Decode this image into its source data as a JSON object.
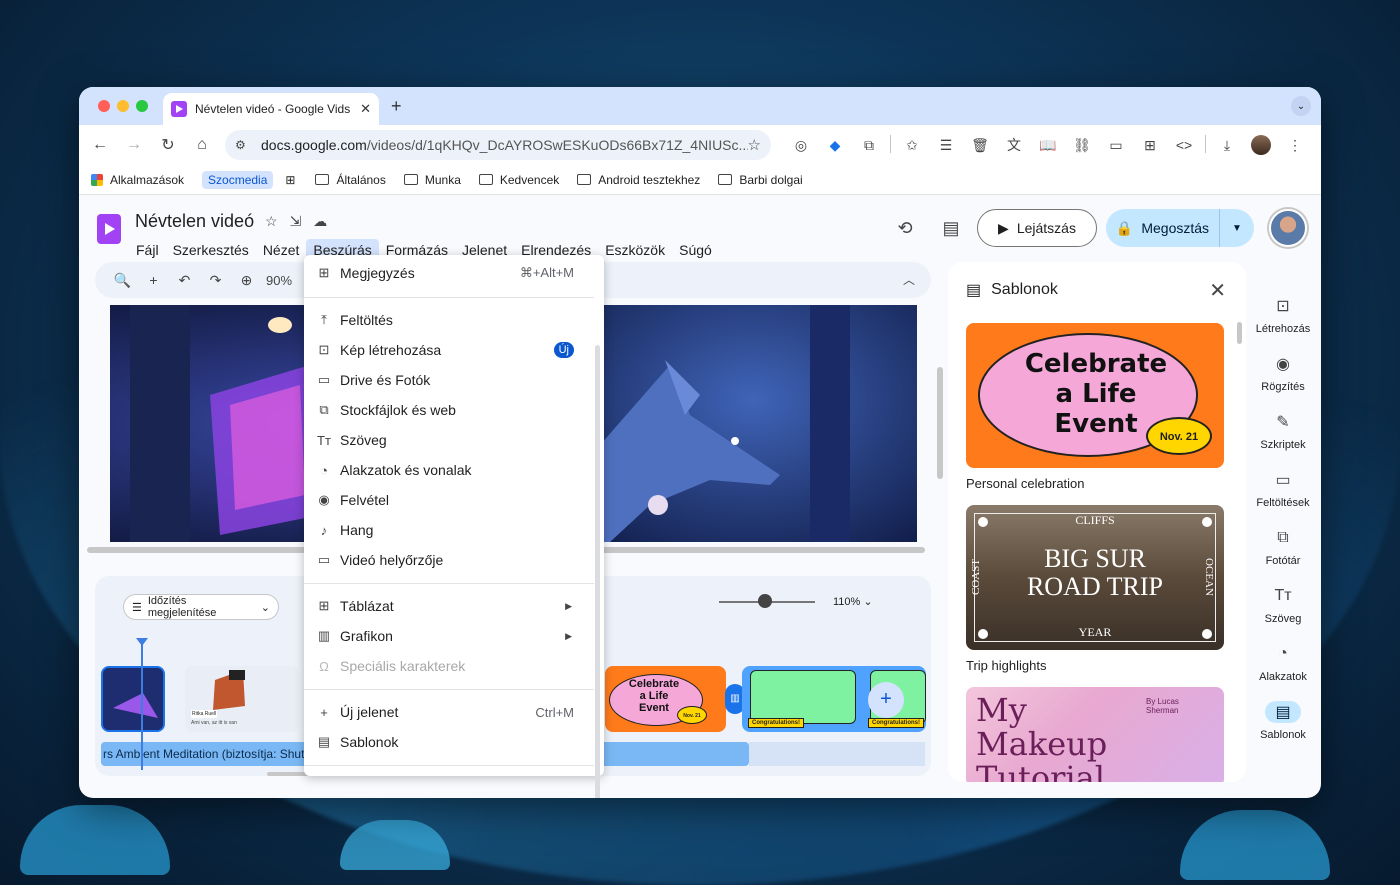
{
  "browser": {
    "tab_title": "Névtelen videó - Google Vids",
    "url_host": "docs.google.com",
    "url_path": "/videos/d/1qKHQv_DcAYROSwESKuODs66Bx71Z_4NIUSc...",
    "bookmarks": [
      "Alkalmazások",
      "Szocmedia",
      "Általános",
      "Munka",
      "Kedvencek",
      "Android tesztekhez",
      "Barbi dolgai"
    ]
  },
  "app": {
    "doc_title": "Névtelen videó",
    "menus": [
      "Fájl",
      "Szerkesztés",
      "Nézet",
      "Beszúrás",
      "Formázás",
      "Jelenet",
      "Elrendezés",
      "Eszközök",
      "Súgó"
    ],
    "play_label": "Lejátszás",
    "share_label": "Megosztás"
  },
  "editor": {
    "zoom": "90%",
    "timing_label": "Időzítés megjelenítése",
    "timeline_zoom": "110%",
    "audio_label": "rs Ambient Meditation (biztosítja: Shutte",
    "slider_level": 0.48
  },
  "insert_menu": {
    "items": [
      {
        "label": "Megjegyzés",
        "shortcut": "⌘+Alt+M",
        "icon": "comment-add-icon"
      },
      {
        "label": "Feltöltés",
        "icon": "upload-icon"
      },
      {
        "label": "Kép létrehozása",
        "badge": "Új",
        "icon": "image-create-icon"
      },
      {
        "label": "Drive és Fotók",
        "icon": "folder-icon"
      },
      {
        "label": "Stockfájlok és web",
        "icon": "stock-image-icon"
      },
      {
        "label": "Szöveg",
        "icon": "text-icon"
      },
      {
        "label": "Alakzatok és vonalak",
        "icon": "shapes-icon"
      },
      {
        "label": "Felvétel",
        "icon": "record-icon"
      },
      {
        "label": "Hang",
        "icon": "mic-icon"
      },
      {
        "label": "Videó helyőrzője",
        "icon": "video-placeholder-icon"
      },
      {
        "label": "Táblázat",
        "icon": "table-icon"
      },
      {
        "label": "Grafikon",
        "icon": "chart-icon"
      },
      {
        "label": "Speciális karakterek",
        "icon": "omega-icon"
      },
      {
        "label": "Új jelenet",
        "shortcut": "Ctrl+M",
        "icon": "plus-icon"
      },
      {
        "label": "Sablonok",
        "icon": "template-icon"
      }
    ]
  },
  "templates_panel": {
    "title": "Sablonok",
    "templates": [
      {
        "label": "Personal celebration",
        "line1": "Celebrate",
        "line2": "a Life",
        "line3": "Event",
        "date": "Nov. 21"
      },
      {
        "label": "Trip highlights",
        "top": "CLIFFS",
        "bottom": "YEAR",
        "left": "COAST",
        "right": "OCEAN",
        "line1": "BIG SUR",
        "line2": "ROAD TRIP"
      },
      {
        "label": "",
        "line1": "My",
        "line2": "Makeup",
        "line3": "Tutorial",
        "byline": "By Lucas Sherman"
      }
    ]
  },
  "rail": {
    "items": [
      "Létrehozás",
      "Rögzítés",
      "Szkriptek",
      "Feltöltések",
      "Fotótár",
      "Szöveg",
      "Alakzatok",
      "Sablonok"
    ]
  },
  "timeline_clips": {
    "celebrate_line1": "Celebrate",
    "celebrate_line2": "a Life",
    "celebrate_line3": "Event",
    "celebrate_date": "Nov. 21",
    "congrats": "Congratulations!",
    "congrats2": "Congratulations!",
    "cartoon_caption": "Ritka Ruell",
    "cartoon_sub": "Ami van, az itt is van"
  },
  "colors": {
    "accent": "#0b57d0",
    "share_bg": "#c2e7ff",
    "tab_strip": "#d3e3fd",
    "vids_purple": "#a142f4"
  }
}
